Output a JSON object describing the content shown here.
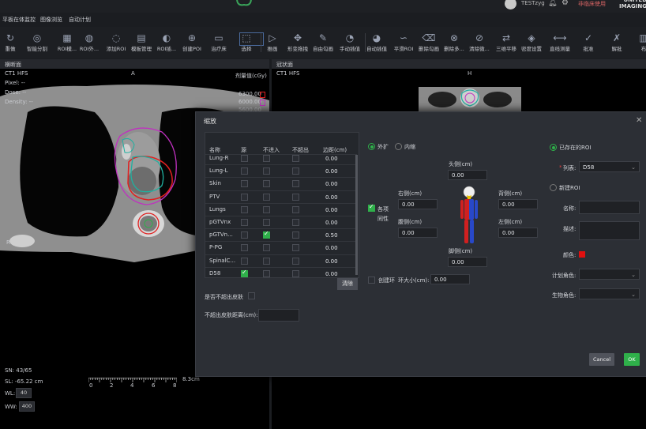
{
  "topbar": {
    "user": "TESTzyg",
    "clinical": "非临床使用",
    "brand": "UNITED IMAGING"
  },
  "menu": [
    "平板在体监控",
    "图像浏览",
    "自动计划"
  ],
  "toolbar": [
    {
      "label": "重做",
      "icon": "redo-icon"
    },
    {
      "label": "智能分割",
      "icon": "smart-seg-icon"
    },
    {
      "label": "ROI模...",
      "icon": "roi-template-icon"
    },
    {
      "label": "ROI外...",
      "icon": "roi-outer-icon"
    },
    {
      "label": "添加ROI",
      "icon": "add-roi-icon"
    },
    {
      "label": "模板管理",
      "icon": "template-manage-icon"
    },
    {
      "label": "ROI插...",
      "icon": "roi-interp-icon"
    },
    {
      "label": "创建POI",
      "icon": "create-poi-icon"
    },
    {
      "label": "治疗床",
      "icon": "couch-icon"
    },
    {
      "label": "选择",
      "icon": "select-icon"
    },
    {
      "label": "推画",
      "icon": "push-draw-icon"
    },
    {
      "label": "形变拖拽",
      "icon": "deform-drag-icon"
    },
    {
      "label": "自由勾画",
      "icon": "free-draw-icon"
    },
    {
      "label": "手动插值",
      "icon": "manual-interp-icon"
    },
    {
      "label": "自动插值",
      "icon": "auto-interp-icon"
    },
    {
      "label": "平滑ROI",
      "icon": "smooth-roi-icon"
    },
    {
      "label": "删除勾画",
      "icon": "delete-contour-icon"
    },
    {
      "label": "删除多...",
      "icon": "delete-multi-icon"
    },
    {
      "label": "清除微...",
      "icon": "clear-small-icon"
    },
    {
      "label": "三维平移",
      "icon": "3d-move-icon"
    },
    {
      "label": "密度设置",
      "icon": "density-icon"
    },
    {
      "label": "直线测量",
      "icon": "ruler-icon"
    },
    {
      "label": "批准",
      "icon": "approve-icon"
    },
    {
      "label": "解批",
      "icon": "unapprove-icon"
    },
    {
      "label": "布",
      "icon": "layout-icon"
    }
  ],
  "left_view": {
    "title": "横断面",
    "scan": "CT1 HFS",
    "orient_top": "A",
    "orient_left": "R",
    "pixel": "Pixel:  --",
    "dose": "Dose:  --",
    "density": "Density:  --",
    "dose_header": "剂量值(cGy)",
    "dose_levels": [
      "6300.00",
      "6000.00",
      "5600.00"
    ],
    "dose_colors": [
      "#e02020",
      "#c030c0",
      "#e08080"
    ],
    "sn": "SN: 43/65",
    "sl": "SL: -65.22 cm",
    "wl_label": "WL:",
    "wl": "40",
    "ww_label": "WW:",
    "ww": "400",
    "scale_ticks": [
      "0",
      "2",
      "4",
      "6",
      "8"
    ],
    "scale_unit": "8.3cm"
  },
  "right_view": {
    "title": "冠状面",
    "scan": "CT1 HFS",
    "orient_top": "H"
  },
  "dialog": {
    "title": "缩放",
    "columns": [
      "名称",
      "源",
      "不进入",
      "不超出",
      "边距(cm)"
    ],
    "rows": [
      {
        "name": "Lung-R",
        "src": false,
        "in": false,
        "out": false,
        "margin": "0.00"
      },
      {
        "name": "Lung-L",
        "src": false,
        "in": false,
        "out": false,
        "margin": "0.00"
      },
      {
        "name": "Skin",
        "src": false,
        "in": false,
        "out": false,
        "margin": "0.00"
      },
      {
        "name": "PTV",
        "src": false,
        "in": false,
        "out": false,
        "margin": "0.00"
      },
      {
        "name": "Lungs",
        "src": false,
        "in": false,
        "out": false,
        "margin": "0.00"
      },
      {
        "name": "pGTVnx",
        "src": false,
        "in": false,
        "out": false,
        "margin": "0.00"
      },
      {
        "name": "pGTVn...",
        "src": false,
        "in": true,
        "out": false,
        "margin": "0.50"
      },
      {
        "name": "P-PG",
        "src": false,
        "in": false,
        "out": false,
        "margin": "0.00"
      },
      {
        "name": "SpinalC...",
        "src": false,
        "in": false,
        "out": false,
        "margin": "0.00"
      },
      {
        "name": "D58",
        "src": true,
        "in": false,
        "out": false,
        "margin": "0.00"
      }
    ],
    "clear": "清除",
    "skin_check": "是否不超出皮肤",
    "skin_dist": "不超出皮肤距离(cm):",
    "expand": "外扩",
    "shrink": "内缩",
    "isotropic": "各项同性",
    "head_lbl": "头侧(cm)",
    "head_val": "0.00",
    "right_lbl": "右侧(cm)",
    "right_val": "0.00",
    "back_lbl": "背侧(cm)",
    "back_val": "0.00",
    "front_lbl": "腹侧(cm)",
    "front_val": "0.00",
    "left_lbl": "左侧(cm)",
    "left_val": "0.00",
    "foot_lbl": "脚侧(cm)",
    "foot_val": "0.00",
    "ring_check": "创建环",
    "ring_size": "环大小(cm):",
    "ring_val": "0.00",
    "existing_roi": "已存在的ROI",
    "list_lbl": "列表:",
    "list_required": "*",
    "list_val": "D58",
    "new_roi": "新建ROI",
    "name_lbl": "名称:",
    "desc_lbl": "描述:",
    "color_lbl": "颜色:",
    "plan_role": "计划角色:",
    "bio_role": "生物角色:",
    "cancel": "Cancel",
    "ok": "OK"
  }
}
